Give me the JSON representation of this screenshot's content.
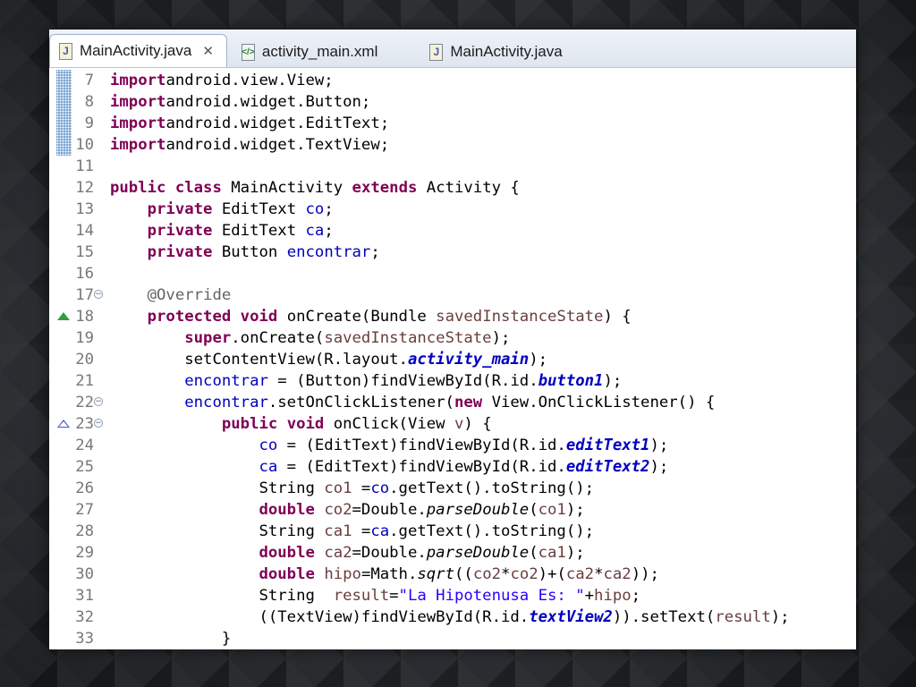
{
  "tabs": [
    {
      "label": "MainActivity.java",
      "icon": "java-file-icon",
      "active": true,
      "closable": true
    },
    {
      "label": "activity_main.xml",
      "icon": "xml-file-icon",
      "active": false
    },
    {
      "label": "MainActivity.java",
      "icon": "java-file-icon",
      "active": false
    }
  ],
  "colors": {
    "keyword": "#7f0055",
    "field": "#0000c0",
    "string": "#2a00ff",
    "annotation": "#646464",
    "local_variable": "#6a3e3e",
    "line_number": "#787878"
  },
  "code_lines": [
    {
      "num": "7",
      "change": true,
      "tokens": [
        [
          "kw",
          "import"
        ],
        [
          "",
          "android.view.View;"
        ]
      ]
    },
    {
      "num": "8",
      "change": true,
      "tokens": [
        [
          "kw",
          "import"
        ],
        [
          "",
          "android.widget.Button;"
        ]
      ]
    },
    {
      "num": "9",
      "change": true,
      "tokens": [
        [
          "kw",
          "import"
        ],
        [
          "",
          "android.widget.EditText;"
        ]
      ]
    },
    {
      "num": "10",
      "change": true,
      "tokens": [
        [
          "kw",
          "import"
        ],
        [
          "",
          "android.widget.TextView;"
        ]
      ]
    },
    {
      "num": "11",
      "tokens": []
    },
    {
      "num": "12",
      "tokens": [
        [
          "kw",
          "public"
        ],
        [
          "",
          " "
        ],
        [
          "kw",
          "class"
        ],
        [
          "",
          " MainActivity "
        ],
        [
          "kw",
          "extends"
        ],
        [
          "",
          " Activity {"
        ]
      ]
    },
    {
      "num": "13",
      "tokens": [
        [
          "",
          "    "
        ],
        [
          "kw",
          "private"
        ],
        [
          "",
          " EditText "
        ],
        [
          "field",
          "co"
        ],
        [
          "",
          ";"
        ]
      ]
    },
    {
      "num": "14",
      "tokens": [
        [
          "",
          "    "
        ],
        [
          "kw",
          "private"
        ],
        [
          "",
          " EditText "
        ],
        [
          "field",
          "ca"
        ],
        [
          "",
          ";"
        ]
      ]
    },
    {
      "num": "15",
      "tokens": [
        [
          "",
          "    "
        ],
        [
          "kw",
          "private"
        ],
        [
          "",
          " Button "
        ],
        [
          "field",
          "encontrar"
        ],
        [
          "",
          ";"
        ]
      ]
    },
    {
      "num": "16",
      "tokens": []
    },
    {
      "num": "17",
      "fold": true,
      "tokens": [
        [
          "",
          "    "
        ],
        [
          "ann",
          "@Override"
        ]
      ]
    },
    {
      "num": "18",
      "marker": "override",
      "tokens": [
        [
          "",
          "    "
        ],
        [
          "kw",
          "protected"
        ],
        [
          "",
          " "
        ],
        [
          "kw",
          "void"
        ],
        [
          "",
          " onCreate(Bundle "
        ],
        [
          "param",
          "savedInstanceState"
        ],
        [
          "",
          ") {"
        ]
      ]
    },
    {
      "num": "19",
      "tokens": [
        [
          "",
          "        "
        ],
        [
          "kw",
          "super"
        ],
        [
          "",
          ".onCreate("
        ],
        [
          "param",
          "savedInstanceState"
        ],
        [
          "",
          ");"
        ]
      ]
    },
    {
      "num": "20",
      "tokens": [
        [
          "",
          "        setContentView(R.layout."
        ],
        [
          "sfield",
          "activity_main"
        ],
        [
          "",
          ");"
        ]
      ]
    },
    {
      "num": "21",
      "tokens": [
        [
          "",
          "        "
        ],
        [
          "field",
          "encontrar"
        ],
        [
          "",
          " = (Button)findViewById(R.id."
        ],
        [
          "sfield",
          "button1"
        ],
        [
          "",
          ");"
        ]
      ]
    },
    {
      "num": "22",
      "fold": true,
      "tokens": [
        [
          "",
          "        "
        ],
        [
          "field",
          "encontrar"
        ],
        [
          "",
          ".setOnClickListener("
        ],
        [
          "kw",
          "new"
        ],
        [
          "",
          " View.OnClickListener() {"
        ]
      ]
    },
    {
      "num": "23",
      "fold": true,
      "marker": "implements",
      "tokens": [
        [
          "",
          "            "
        ],
        [
          "kw",
          "public"
        ],
        [
          "",
          " "
        ],
        [
          "kw",
          "void"
        ],
        [
          "",
          " onClick(View "
        ],
        [
          "param",
          "v"
        ],
        [
          "",
          ") {"
        ]
      ]
    },
    {
      "num": "24",
      "tokens": [
        [
          "",
          "                "
        ],
        [
          "field",
          "co"
        ],
        [
          "",
          " = (EditText)findViewById(R.id."
        ],
        [
          "sfield",
          "editText1"
        ],
        [
          "",
          ");"
        ]
      ]
    },
    {
      "num": "25",
      "tokens": [
        [
          "",
          "                "
        ],
        [
          "field",
          "ca"
        ],
        [
          "",
          " = (EditText)findViewById(R.id."
        ],
        [
          "sfield",
          "editText2"
        ],
        [
          "",
          ");"
        ]
      ]
    },
    {
      "num": "26",
      "tokens": [
        [
          "",
          "                String "
        ],
        [
          "lvar",
          "co1"
        ],
        [
          "",
          " ="
        ],
        [
          "field",
          "co"
        ],
        [
          "",
          ".getText().toString();"
        ]
      ]
    },
    {
      "num": "27",
      "tokens": [
        [
          "",
          "                "
        ],
        [
          "kw",
          "double"
        ],
        [
          "",
          " "
        ],
        [
          "lvar",
          "co2"
        ],
        [
          "",
          "=Double."
        ],
        [
          "smeth",
          "parseDouble"
        ],
        [
          "",
          "("
        ],
        [
          "lvar",
          "co1"
        ],
        [
          "",
          ");"
        ]
      ]
    },
    {
      "num": "28",
      "tokens": [
        [
          "",
          "                String "
        ],
        [
          "lvar",
          "ca1"
        ],
        [
          "",
          " ="
        ],
        [
          "field",
          "ca"
        ],
        [
          "",
          ".getText().toString();"
        ]
      ]
    },
    {
      "num": "29",
      "tokens": [
        [
          "",
          "                "
        ],
        [
          "kw",
          "double"
        ],
        [
          "",
          " "
        ],
        [
          "lvar",
          "ca2"
        ],
        [
          "",
          "=Double."
        ],
        [
          "smeth",
          "parseDouble"
        ],
        [
          "",
          "("
        ],
        [
          "lvar",
          "ca1"
        ],
        [
          "",
          ");"
        ]
      ]
    },
    {
      "num": "30",
      "tokens": [
        [
          "",
          "                "
        ],
        [
          "kw",
          "double"
        ],
        [
          "",
          " "
        ],
        [
          "lvar",
          "hipo"
        ],
        [
          "",
          "=Math."
        ],
        [
          "smeth",
          "sqrt"
        ],
        [
          "",
          "(("
        ],
        [
          "lvar",
          "co2"
        ],
        [
          "",
          "*"
        ],
        [
          "lvar",
          "co2"
        ],
        [
          "",
          ")+("
        ],
        [
          "lvar",
          "ca2"
        ],
        [
          "",
          "*"
        ],
        [
          "lvar",
          "ca2"
        ],
        [
          "",
          "));"
        ]
      ]
    },
    {
      "num": "31",
      "tokens": [
        [
          "",
          "                String  "
        ],
        [
          "lvar",
          "result"
        ],
        [
          "",
          "="
        ],
        [
          "str",
          "\"La Hipotenusa Es: \""
        ],
        [
          "",
          "+"
        ],
        [
          "lvar",
          "hipo"
        ],
        [
          "",
          ";"
        ]
      ]
    },
    {
      "num": "32",
      "tokens": [
        [
          "",
          "                ((TextView)findViewById(R.id."
        ],
        [
          "sfield",
          "textView2"
        ],
        [
          "",
          ")).setText("
        ],
        [
          "lvar",
          "result"
        ],
        [
          "",
          ");"
        ]
      ]
    },
    {
      "num": "33",
      "tokens": [
        [
          "",
          "            }"
        ]
      ]
    }
  ]
}
